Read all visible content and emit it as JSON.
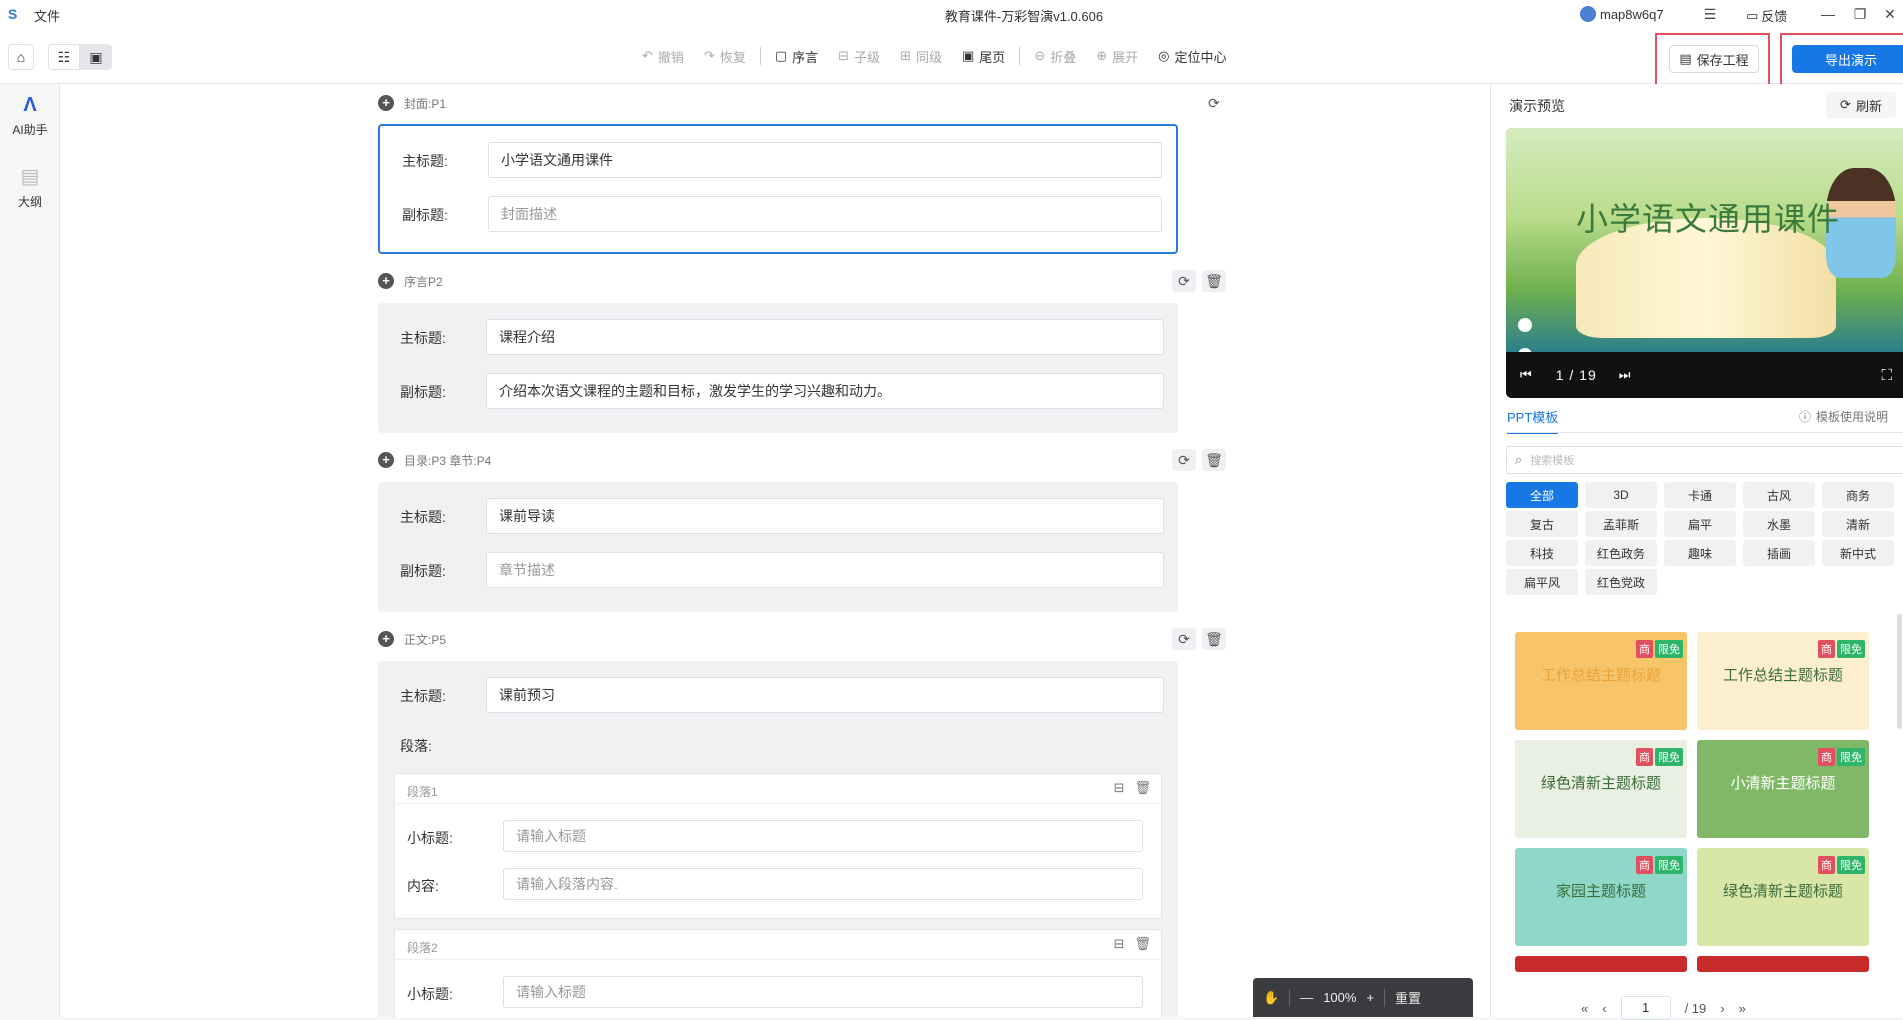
{
  "window": {
    "file_menu": "文件",
    "title": "教育课件-万彩智演v1.0.606",
    "user": "map8w6q7",
    "feedback": "反馈"
  },
  "toolbar": {
    "undo": "撤销",
    "redo": "恢复",
    "preface": "序言",
    "child": "子级",
    "sibling": "同级",
    "end_page": "尾页",
    "collapse": "折叠",
    "expand": "展开",
    "locate_center": "定位中心",
    "save_project": "保存工程",
    "export": "导出演示"
  },
  "rail": {
    "ai": "AI助手",
    "outline": "大纲"
  },
  "sections": [
    {
      "head": "封面:P1",
      "title_label": "主标题:",
      "title_value": "小学语文通用课件",
      "sub_label": "副标题:",
      "sub_placeholder": "封面描述"
    },
    {
      "head": "序言P2",
      "title_label": "主标题:",
      "title_value": "课程介绍",
      "sub_label": "副标题:",
      "sub_value": "介绍本次语文课程的主题和目标，激发学生的学习兴趣和动力。"
    },
    {
      "head": "目录:P3  章节:P4",
      "title_label": "主标题:",
      "title_value": "课前导读",
      "sub_label": "副标题:",
      "sub_placeholder": "章节描述"
    },
    {
      "head": "正文:P5",
      "title_label": "主标题:",
      "title_value": "课前预习",
      "para_label": "段落:",
      "paragraphs": [
        {
          "head": "段落1",
          "sub_label": "小标题:",
          "sub_placeholder": "请输入标题",
          "content_label": "内容:",
          "content_placeholder": "请输入段落内容."
        },
        {
          "head": "段落2",
          "sub_label": "小标题:",
          "sub_placeholder": "请输入标题"
        }
      ]
    }
  ],
  "zoom": {
    "level": "100%",
    "reset": "重置"
  },
  "preview": {
    "label": "演示预览",
    "refresh": "刷新",
    "slide_title": "小学语文通用课件",
    "page": "1 / 19"
  },
  "templates": {
    "tab": "PPT模板",
    "help": "模板使用说明",
    "search_placeholder": "搜索模板",
    "categories": [
      "全部",
      "3D",
      "卡通",
      "古风",
      "商务",
      "复古",
      "孟菲斯",
      "扁平",
      "水墨",
      "清新",
      "科技",
      "红色政务",
      "趣味",
      "插画",
      "新中式",
      "扁平风",
      "红色党政"
    ],
    "badge_biz": "商",
    "badge_free": "限免",
    "thumbs": [
      {
        "title": "工作总结主题标题",
        "bg": "#f7c46a"
      },
      {
        "title": "工作总结主题标题",
        "bg": "#fbefcf"
      },
      {
        "title": "绿色清新主题标题",
        "bg": "#e9efe1"
      },
      {
        "title": "小清新主题标题",
        "bg": "#7fb866"
      },
      {
        "title": "家园主题标题",
        "bg": "#8fd7c9"
      },
      {
        "title": "绿色清新主题标题",
        "bg": "#d8e6a8"
      }
    ],
    "pager_current": "1",
    "pager_total": "/ 19"
  },
  "colors": {
    "accent": "#1677e5",
    "highlight": "#e2505f"
  }
}
